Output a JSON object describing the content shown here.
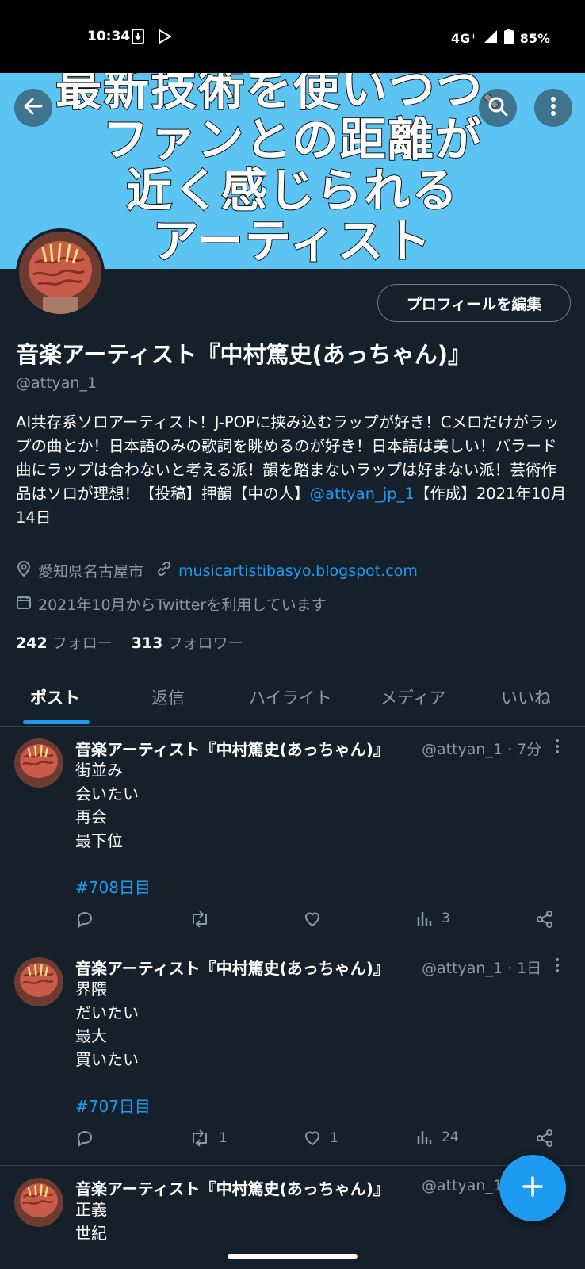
{
  "status_bar": {
    "time": "10:34",
    "network": "4G⁺",
    "battery": "85%"
  },
  "banner": {
    "lines": [
      "最新技術を使いつつ、",
      "ファンとの距離が",
      "近く感じられる",
      "アーティスト"
    ]
  },
  "profile": {
    "edit_button": "プロフィールを編集",
    "name": "音楽アーティスト『中村篤史(あっちゃん)』",
    "handle": "@attyan_1",
    "bio_text": "AI共存系ソロアーティスト！J-POPに挟み込むラップが好き！Cメロだけがラップの曲とか！日本語のみの歌詞を眺めるのが好き！日本語は美しい！バラード曲にラップは合わないと考える派！韻を踏まないラップは好まない派！芸術作品はソロが理想！【投稿】押韻【中の人】",
    "bio_link": "@attyan_jp_1",
    "bio_tail": "【作成】2021年10月14日",
    "location": "愛知県名古屋市",
    "website": "musicartistibasyo.blogspot.com",
    "joined": "2021年10月からTwitterを利用しています",
    "following_count": "242",
    "following_label": "フォロー",
    "followers_count": "313",
    "followers_label": "フォロワー"
  },
  "tabs": [
    "ポスト",
    "返信",
    "ハイライト",
    "メディア",
    "いいね"
  ],
  "posts": [
    {
      "name": "音楽アーティスト『中村篤史(あっちゃん)』",
      "meta": "@attyan_1 · 7分",
      "lines": [
        "街並み",
        "会いたい",
        "再会",
        "最下位"
      ],
      "hashtag": "#708日目",
      "replies": "",
      "reposts": "",
      "likes": "",
      "views": "3"
    },
    {
      "name": "音楽アーティスト『中村篤史(あっちゃん)』",
      "meta": "@attyan_1 · 1日",
      "lines": [
        "界隈",
        "だいたい",
        "最大",
        "買いたい"
      ],
      "hashtag": "#707日目",
      "replies": "",
      "reposts": "1",
      "likes": "1",
      "views": "24"
    },
    {
      "name": "音楽アーティスト『中村篤史(あっちゃん)』",
      "meta": "@attyan_1",
      "lines": [
        "正義",
        "世紀"
      ]
    }
  ],
  "colors": {
    "background": "#15202b",
    "accent": "#1d9bf0",
    "secondary_text": "#8b98a5",
    "banner": "#5cc4f2"
  },
  "icons": [
    "back-arrow-icon",
    "search-icon",
    "more-vertical-icon",
    "location-pin-icon",
    "link-icon",
    "calendar-icon",
    "reply-icon",
    "repost-icon",
    "like-icon",
    "views-icon",
    "share-icon",
    "plus-icon"
  ]
}
